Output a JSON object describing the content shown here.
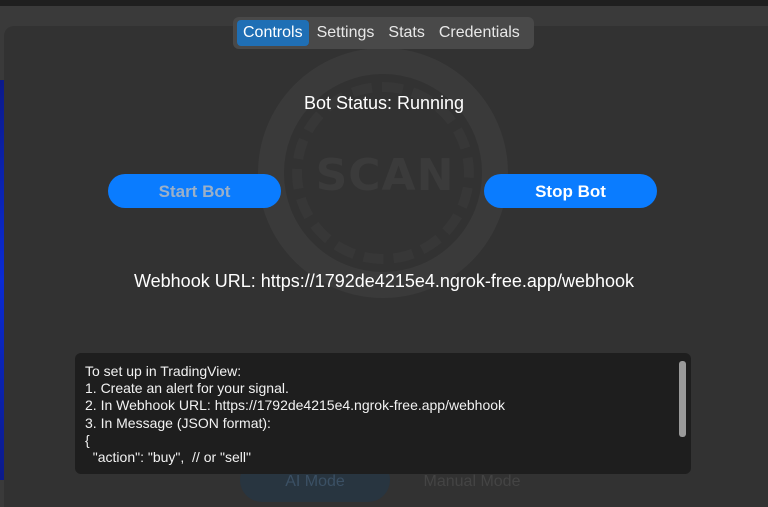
{
  "tabs": [
    {
      "label": "Controls",
      "active": true
    },
    {
      "label": "Settings",
      "active": false
    },
    {
      "label": "Stats",
      "active": false
    },
    {
      "label": "Credentials",
      "active": false
    }
  ],
  "watermark": {
    "text": "SCAN"
  },
  "status": {
    "text": "Bot Status: Running"
  },
  "buttons": {
    "start": "Start Bot",
    "stop": "Stop Bot"
  },
  "webhook": {
    "text": "Webhook URL: https://1792de4215e4.ngrok-free.app/webhook"
  },
  "instructions": {
    "lines": [
      "To set up in TradingView:",
      "1. Create an alert for your signal.",
      "2. In Webhook URL: https://1792de4215e4.ngrok-free.app/webhook",
      "3. In Message (JSON format):",
      "{",
      "  \"action\": \"buy\",  // or \"sell\""
    ]
  },
  "mode_buttons": {
    "ai": "AI Mode",
    "manual": "Manual Mode"
  },
  "colors": {
    "accent": "#0a7cff",
    "active_tab": "#1f6fb5",
    "background": "#323232"
  }
}
